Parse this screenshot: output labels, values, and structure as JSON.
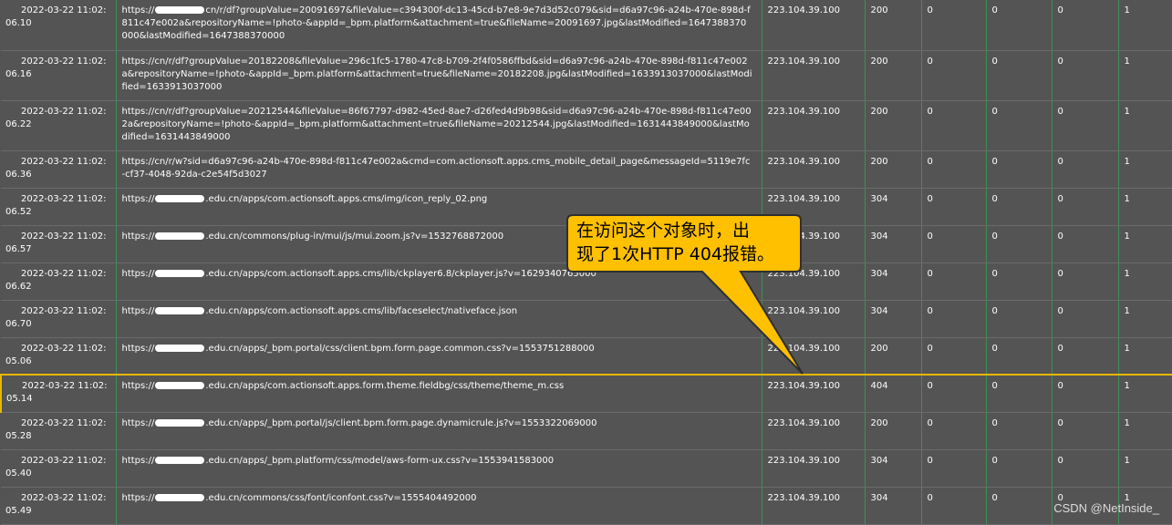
{
  "rows": [
    {
      "time_line1": "2022-03-22 11:02:",
      "time_line2": "06.10",
      "url_prefix": "https://",
      "url_host": "",
      "url": "cn/r/df?groupValue=20091697&fileValue=c394300f-dc13-45cd-b7e8-9e7d3d52c079&sid=d6a97c96-a24b-470e-898d-f811c47e002a&repositoryName=!photo-&appId=_bpm.platform&attachment=true&fileName=20091697.jpg&lastModified=1647388370000&lastModified=1647388370000",
      "ip": "223.104.39.100",
      "status": "200",
      "c1": "0",
      "c2": "0",
      "c3": "0",
      "c4": "1",
      "redacted": true,
      "start_partial": true
    },
    {
      "time_line1": "2022-03-22 11:02:",
      "time_line2": "06.16",
      "url": "cn/r/df?groupValue=20182208&fileValue=296c1fc5-1780-47c8-b709-2f4f0586ffbd&sid=d6a97c96-a24b-470e-898d-f811c47e002a&repositoryName=!photo-&appId=_bpm.platform&attachment=true&fileName=20182208.jpg&lastModified=1633913037000&lastModified=1633913037000",
      "ip": "223.104.39.100",
      "status": "200",
      "c1": "0",
      "c2": "0",
      "c3": "0",
      "c4": "1"
    },
    {
      "time_line1": "2022-03-22 11:02:",
      "time_line2": "06.22",
      "url": "cn/r/df?groupValue=20212544&fileValue=86f67797-d982-45ed-8ae7-d26fed4d9b98&sid=d6a97c96-a24b-470e-898d-f811c47e002a&repositoryName=!photo-&appId=_bpm.platform&attachment=true&fileName=20212544.jpg&lastModified=1631443849000&lastModified=1631443849000",
      "ip": "223.104.39.100",
      "status": "200",
      "c1": "0",
      "c2": "0",
      "c3": "0",
      "c4": "1"
    },
    {
      "time_line1": "2022-03-22 11:02:",
      "time_line2": "06.36",
      "url": "cn/r/w?sid=d6a97c96-a24b-470e-898d-f811c47e002a&cmd=com.actionsoft.apps.cms_mobile_detail_page&messageId=5119e7fc-cf37-4048-92da-c2e54f5d3027",
      "ip": "223.104.39.100",
      "status": "200",
      "c1": "0",
      "c2": "0",
      "c3": "0",
      "c4": "1"
    },
    {
      "time_line1": "2022-03-22 11:02:",
      "time_line2": "06.52",
      "url": ".edu.cn/apps/com.actionsoft.apps.cms/img/icon_reply_02.png",
      "ip": "223.104.39.100",
      "status": "304",
      "c1": "0",
      "c2": "0",
      "c3": "0",
      "c4": "1",
      "redacted": true
    },
    {
      "time_line1": "2022-03-22 11:02:",
      "time_line2": "06.57",
      "url": ".edu.cn/commons/plug-in/mui/js/mui.zoom.js?v=1532768872000",
      "ip": "223.104.39.100",
      "status": "304",
      "c1": "0",
      "c2": "0",
      "c3": "0",
      "c4": "1",
      "redacted": true
    },
    {
      "time_line1": "2022-03-22 11:02:",
      "time_line2": "06.62",
      "url": ".edu.cn/apps/com.actionsoft.apps.cms/lib/ckplayer6.8/ckplayer.js?v=1629340765000",
      "ip": "223.104.39.100",
      "status": "304",
      "c1": "0",
      "c2": "0",
      "c3": "0",
      "c4": "1",
      "redacted": true
    },
    {
      "time_line1": "2022-03-22 11:02:",
      "time_line2": "06.70",
      "url": ".edu.cn/apps/com.actionsoft.apps.cms/lib/faceselect/nativeface.json",
      "ip": "223.104.39.100",
      "status": "304",
      "c1": "0",
      "c2": "0",
      "c3": "0",
      "c4": "1",
      "redacted": true
    },
    {
      "time_line1": "2022-03-22 11:02:",
      "time_line2": "05.06",
      "url": ".edu.cn/apps/_bpm.portal/css/client.bpm.form.page.common.css?v=1553751288000",
      "ip": "223.104.39.100",
      "status": "200",
      "c1": "0",
      "c2": "0",
      "c3": "0",
      "c4": "1",
      "redacted": true
    },
    {
      "time_line1": "2022-03-22 11:02:",
      "time_line2": "05.14",
      "url": ".edu.cn/apps/com.actionsoft.apps.form.theme.fieldbg/css/theme/theme_m.css",
      "ip": "223.104.39.100",
      "status": "404",
      "c1": "0",
      "c2": "0",
      "c3": "0",
      "c4": "1",
      "redacted": true,
      "highlighted": true
    },
    {
      "time_line1": "2022-03-22 11:02:",
      "time_line2": "05.28",
      "url": ".edu.cn/apps/_bpm.portal/js/client.bpm.form.page.dynamicrule.js?v=1553322069000",
      "ip": "223.104.39.100",
      "status": "200",
      "c1": "0",
      "c2": "0",
      "c3": "0",
      "c4": "1",
      "redacted": true
    },
    {
      "time_line1": "2022-03-22 11:02:",
      "time_line2": "05.40",
      "url": ".edu.cn/apps/_bpm.platform/css/model/aws-form-ux.css?v=1553941583000",
      "ip": "223.104.39.100",
      "status": "304",
      "c1": "0",
      "c2": "0",
      "c3": "0",
      "c4": "1",
      "redacted": true
    },
    {
      "time_line1": "2022-03-22 11:02:",
      "time_line2": "05.49",
      "url": ".edu.cn/commons/css/font/iconfont.css?v=1555404492000",
      "ip": "223.104.39.100",
      "status": "304",
      "c1": "0",
      "c2": "0",
      "c3": "0",
      "c4": "1",
      "redacted": true
    }
  ],
  "url_scheme": "https://",
  "callout": {
    "text_line1": "在访问这个对象时，出",
    "text_line2": "现了1次HTTP 404报错。",
    "fill": "#ffc000",
    "stroke": "#2f2f2f"
  },
  "watermark": "CSDN @NetInside_",
  "colors": {
    "background": "#545454",
    "grid": "#3f8f5a",
    "highlight": "#e6b800"
  }
}
